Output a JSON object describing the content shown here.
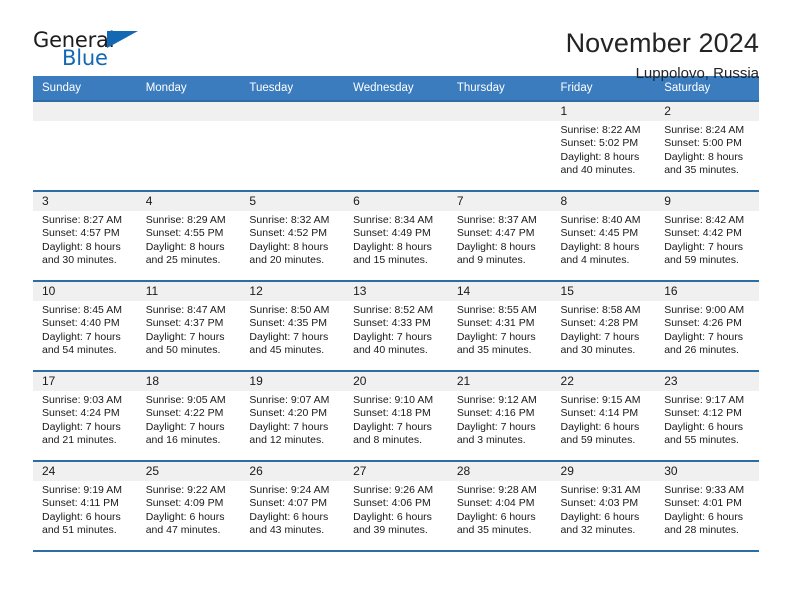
{
  "brand": {
    "name_part1": "General",
    "name_part2": "Blue",
    "color_dark": "#1c1c1c",
    "color_blue": "#1268b3"
  },
  "header": {
    "title": "November 2024",
    "subtitle": "Luppolovo, Russia"
  },
  "theme": {
    "header_bg": "#3b7cbf",
    "row_border": "#2e6da4",
    "daynum_bg": "#f0f0f0",
    "text": "#1a1a1a"
  },
  "weekday_headers": [
    "Sunday",
    "Monday",
    "Tuesday",
    "Wednesday",
    "Thursday",
    "Friday",
    "Saturday"
  ],
  "weeks": [
    [
      {
        "day": "",
        "sunrise": "",
        "sunset": "",
        "daylight1": "",
        "daylight2": ""
      },
      {
        "day": "",
        "sunrise": "",
        "sunset": "",
        "daylight1": "",
        "daylight2": ""
      },
      {
        "day": "",
        "sunrise": "",
        "sunset": "",
        "daylight1": "",
        "daylight2": ""
      },
      {
        "day": "",
        "sunrise": "",
        "sunset": "",
        "daylight1": "",
        "daylight2": ""
      },
      {
        "day": "",
        "sunrise": "",
        "sunset": "",
        "daylight1": "",
        "daylight2": ""
      },
      {
        "day": "1",
        "sunrise": "Sunrise: 8:22 AM",
        "sunset": "Sunset: 5:02 PM",
        "daylight1": "Daylight: 8 hours",
        "daylight2": "and 40 minutes."
      },
      {
        "day": "2",
        "sunrise": "Sunrise: 8:24 AM",
        "sunset": "Sunset: 5:00 PM",
        "daylight1": "Daylight: 8 hours",
        "daylight2": "and 35 minutes."
      }
    ],
    [
      {
        "day": "3",
        "sunrise": "Sunrise: 8:27 AM",
        "sunset": "Sunset: 4:57 PM",
        "daylight1": "Daylight: 8 hours",
        "daylight2": "and 30 minutes."
      },
      {
        "day": "4",
        "sunrise": "Sunrise: 8:29 AM",
        "sunset": "Sunset: 4:55 PM",
        "daylight1": "Daylight: 8 hours",
        "daylight2": "and 25 minutes."
      },
      {
        "day": "5",
        "sunrise": "Sunrise: 8:32 AM",
        "sunset": "Sunset: 4:52 PM",
        "daylight1": "Daylight: 8 hours",
        "daylight2": "and 20 minutes."
      },
      {
        "day": "6",
        "sunrise": "Sunrise: 8:34 AM",
        "sunset": "Sunset: 4:49 PM",
        "daylight1": "Daylight: 8 hours",
        "daylight2": "and 15 minutes."
      },
      {
        "day": "7",
        "sunrise": "Sunrise: 8:37 AM",
        "sunset": "Sunset: 4:47 PM",
        "daylight1": "Daylight: 8 hours",
        "daylight2": "and 9 minutes."
      },
      {
        "day": "8",
        "sunrise": "Sunrise: 8:40 AM",
        "sunset": "Sunset: 4:45 PM",
        "daylight1": "Daylight: 8 hours",
        "daylight2": "and 4 minutes."
      },
      {
        "day": "9",
        "sunrise": "Sunrise: 8:42 AM",
        "sunset": "Sunset: 4:42 PM",
        "daylight1": "Daylight: 7 hours",
        "daylight2": "and 59 minutes."
      }
    ],
    [
      {
        "day": "10",
        "sunrise": "Sunrise: 8:45 AM",
        "sunset": "Sunset: 4:40 PM",
        "daylight1": "Daylight: 7 hours",
        "daylight2": "and 54 minutes."
      },
      {
        "day": "11",
        "sunrise": "Sunrise: 8:47 AM",
        "sunset": "Sunset: 4:37 PM",
        "daylight1": "Daylight: 7 hours",
        "daylight2": "and 50 minutes."
      },
      {
        "day": "12",
        "sunrise": "Sunrise: 8:50 AM",
        "sunset": "Sunset: 4:35 PM",
        "daylight1": "Daylight: 7 hours",
        "daylight2": "and 45 minutes."
      },
      {
        "day": "13",
        "sunrise": "Sunrise: 8:52 AM",
        "sunset": "Sunset: 4:33 PM",
        "daylight1": "Daylight: 7 hours",
        "daylight2": "and 40 minutes."
      },
      {
        "day": "14",
        "sunrise": "Sunrise: 8:55 AM",
        "sunset": "Sunset: 4:31 PM",
        "daylight1": "Daylight: 7 hours",
        "daylight2": "and 35 minutes."
      },
      {
        "day": "15",
        "sunrise": "Sunrise: 8:58 AM",
        "sunset": "Sunset: 4:28 PM",
        "daylight1": "Daylight: 7 hours",
        "daylight2": "and 30 minutes."
      },
      {
        "day": "16",
        "sunrise": "Sunrise: 9:00 AM",
        "sunset": "Sunset: 4:26 PM",
        "daylight1": "Daylight: 7 hours",
        "daylight2": "and 26 minutes."
      }
    ],
    [
      {
        "day": "17",
        "sunrise": "Sunrise: 9:03 AM",
        "sunset": "Sunset: 4:24 PM",
        "daylight1": "Daylight: 7 hours",
        "daylight2": "and 21 minutes."
      },
      {
        "day": "18",
        "sunrise": "Sunrise: 9:05 AM",
        "sunset": "Sunset: 4:22 PM",
        "daylight1": "Daylight: 7 hours",
        "daylight2": "and 16 minutes."
      },
      {
        "day": "19",
        "sunrise": "Sunrise: 9:07 AM",
        "sunset": "Sunset: 4:20 PM",
        "daylight1": "Daylight: 7 hours",
        "daylight2": "and 12 minutes."
      },
      {
        "day": "20",
        "sunrise": "Sunrise: 9:10 AM",
        "sunset": "Sunset: 4:18 PM",
        "daylight1": "Daylight: 7 hours",
        "daylight2": "and 8 minutes."
      },
      {
        "day": "21",
        "sunrise": "Sunrise: 9:12 AM",
        "sunset": "Sunset: 4:16 PM",
        "daylight1": "Daylight: 7 hours",
        "daylight2": "and 3 minutes."
      },
      {
        "day": "22",
        "sunrise": "Sunrise: 9:15 AM",
        "sunset": "Sunset: 4:14 PM",
        "daylight1": "Daylight: 6 hours",
        "daylight2": "and 59 minutes."
      },
      {
        "day": "23",
        "sunrise": "Sunrise: 9:17 AM",
        "sunset": "Sunset: 4:12 PM",
        "daylight1": "Daylight: 6 hours",
        "daylight2": "and 55 minutes."
      }
    ],
    [
      {
        "day": "24",
        "sunrise": "Sunrise: 9:19 AM",
        "sunset": "Sunset: 4:11 PM",
        "daylight1": "Daylight: 6 hours",
        "daylight2": "and 51 minutes."
      },
      {
        "day": "25",
        "sunrise": "Sunrise: 9:22 AM",
        "sunset": "Sunset: 4:09 PM",
        "daylight1": "Daylight: 6 hours",
        "daylight2": "and 47 minutes."
      },
      {
        "day": "26",
        "sunrise": "Sunrise: 9:24 AM",
        "sunset": "Sunset: 4:07 PM",
        "daylight1": "Daylight: 6 hours",
        "daylight2": "and 43 minutes."
      },
      {
        "day": "27",
        "sunrise": "Sunrise: 9:26 AM",
        "sunset": "Sunset: 4:06 PM",
        "daylight1": "Daylight: 6 hours",
        "daylight2": "and 39 minutes."
      },
      {
        "day": "28",
        "sunrise": "Sunrise: 9:28 AM",
        "sunset": "Sunset: 4:04 PM",
        "daylight1": "Daylight: 6 hours",
        "daylight2": "and 35 minutes."
      },
      {
        "day": "29",
        "sunrise": "Sunrise: 9:31 AM",
        "sunset": "Sunset: 4:03 PM",
        "daylight1": "Daylight: 6 hours",
        "daylight2": "and 32 minutes."
      },
      {
        "day": "30",
        "sunrise": "Sunrise: 9:33 AM",
        "sunset": "Sunset: 4:01 PM",
        "daylight1": "Daylight: 6 hours",
        "daylight2": "and 28 minutes."
      }
    ]
  ]
}
